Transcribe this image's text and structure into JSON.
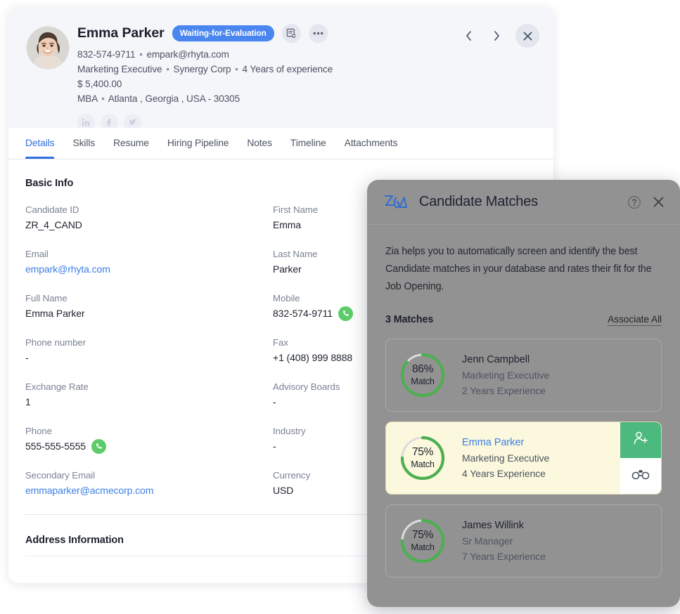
{
  "record": {
    "candidate_name": "Emma Parker",
    "status_badge": "Waiting-for-Evaluation",
    "meta": {
      "phone": "832-574-9711",
      "email": "empark@rhyta.com",
      "title": "Marketing Executive",
      "company": "Synergy Corp",
      "experience": "4 Years of experience",
      "salary": "$ 5,400.00",
      "education": "MBA",
      "location": "Atlanta , Georgia , USA - 30305"
    },
    "social": [
      {
        "name": "linkedin-icon",
        "label": "in"
      },
      {
        "name": "facebook-icon",
        "label": "f"
      },
      {
        "name": "twitter-icon",
        "label": "t"
      }
    ],
    "header_icons": {
      "note_icon": "note-refresh-icon",
      "more_icon": "more-options-icon",
      "prev_icon": "chevron-left-icon",
      "next_icon": "chevron-right-icon",
      "close_icon": "close-icon"
    },
    "tabs": [
      {
        "label": "Details",
        "active": true
      },
      {
        "label": "Skills",
        "active": false
      },
      {
        "label": "Resume",
        "active": false
      },
      {
        "label": "Hiring Pipeline",
        "active": false
      },
      {
        "label": "Notes",
        "active": false
      },
      {
        "label": "Timeline",
        "active": false
      },
      {
        "label": "Attachments",
        "active": false
      }
    ],
    "basic_info_title": "Basic Info",
    "address_info_title": "Address Information",
    "fields_left": [
      {
        "label": "Candidate ID",
        "value": "ZR_4_CAND",
        "link": false,
        "phone": false
      },
      {
        "label": "Email",
        "value": "empark@rhyta.com",
        "link": true,
        "phone": false
      },
      {
        "label": "Full Name",
        "value": "Emma Parker",
        "link": false,
        "phone": false
      },
      {
        "label": "Phone number",
        "value": "-",
        "link": false,
        "phone": false
      },
      {
        "label": "Exchange Rate",
        "value": "1",
        "link": false,
        "phone": false
      },
      {
        "label": "Phone",
        "value": "555-555-5555",
        "link": false,
        "phone": true
      },
      {
        "label": "Secondary Email",
        "value": "emmaparker@acmecorp.com",
        "link": true,
        "phone": false
      }
    ],
    "fields_right": [
      {
        "label": "First Name",
        "value": "Emma",
        "link": false,
        "phone": false
      },
      {
        "label": "Last Name",
        "value": "Parker",
        "link": false,
        "phone": false
      },
      {
        "label": "Mobile",
        "value": "832-574-9711",
        "link": false,
        "phone": true
      },
      {
        "label": "Fax",
        "value": "+1 (408) 999 8888",
        "link": false,
        "phone": false
      },
      {
        "label": "Advisory Boards",
        "value": "-",
        "link": false,
        "phone": false
      },
      {
        "label": "Industry",
        "value": "-",
        "link": false,
        "phone": false
      },
      {
        "label": "Currency",
        "value": "USD",
        "link": false,
        "phone": false
      }
    ]
  },
  "zia_panel": {
    "logo": "zia-logo",
    "title": "Candidate Matches",
    "help_icon": "help-icon",
    "close_icon": "close-icon",
    "description": "Zia helps you to automatically screen and identify the best Candidate matches in your database and rates their fit for the Job Opening.",
    "matches_count": "3 Matches",
    "associate_all": "Associate All",
    "matches": [
      {
        "percent": "86%",
        "percent_value": 86,
        "match_label": "Match",
        "name": "Jenn Campbell",
        "role": "Marketing Executive",
        "experience": "2 Years Experience",
        "highlighted": false
      },
      {
        "percent": "75%",
        "percent_value": 75,
        "match_label": "Match",
        "name": "Emma Parker",
        "role": "Marketing Executive",
        "experience": "4 Years Experience",
        "highlighted": true,
        "actions": [
          {
            "name": "associate-candidate-button",
            "icon": "add-person-icon"
          },
          {
            "name": "view-candidate-button",
            "icon": "binoculars-icon"
          }
        ]
      },
      {
        "percent": "75%",
        "percent_value": 75,
        "match_label": "Match",
        "name": "James Willink",
        "role": "Sr Manager",
        "experience": "7 Years Experience",
        "highlighted": false
      }
    ]
  },
  "colors": {
    "accent_blue": "#3d7fe8",
    "badge_blue": "#4a86f0",
    "ring_green": "#4caf50",
    "action_green": "#4cb97e",
    "panel_grey": "#929292",
    "highlight_cream": "#fbf8dd"
  }
}
